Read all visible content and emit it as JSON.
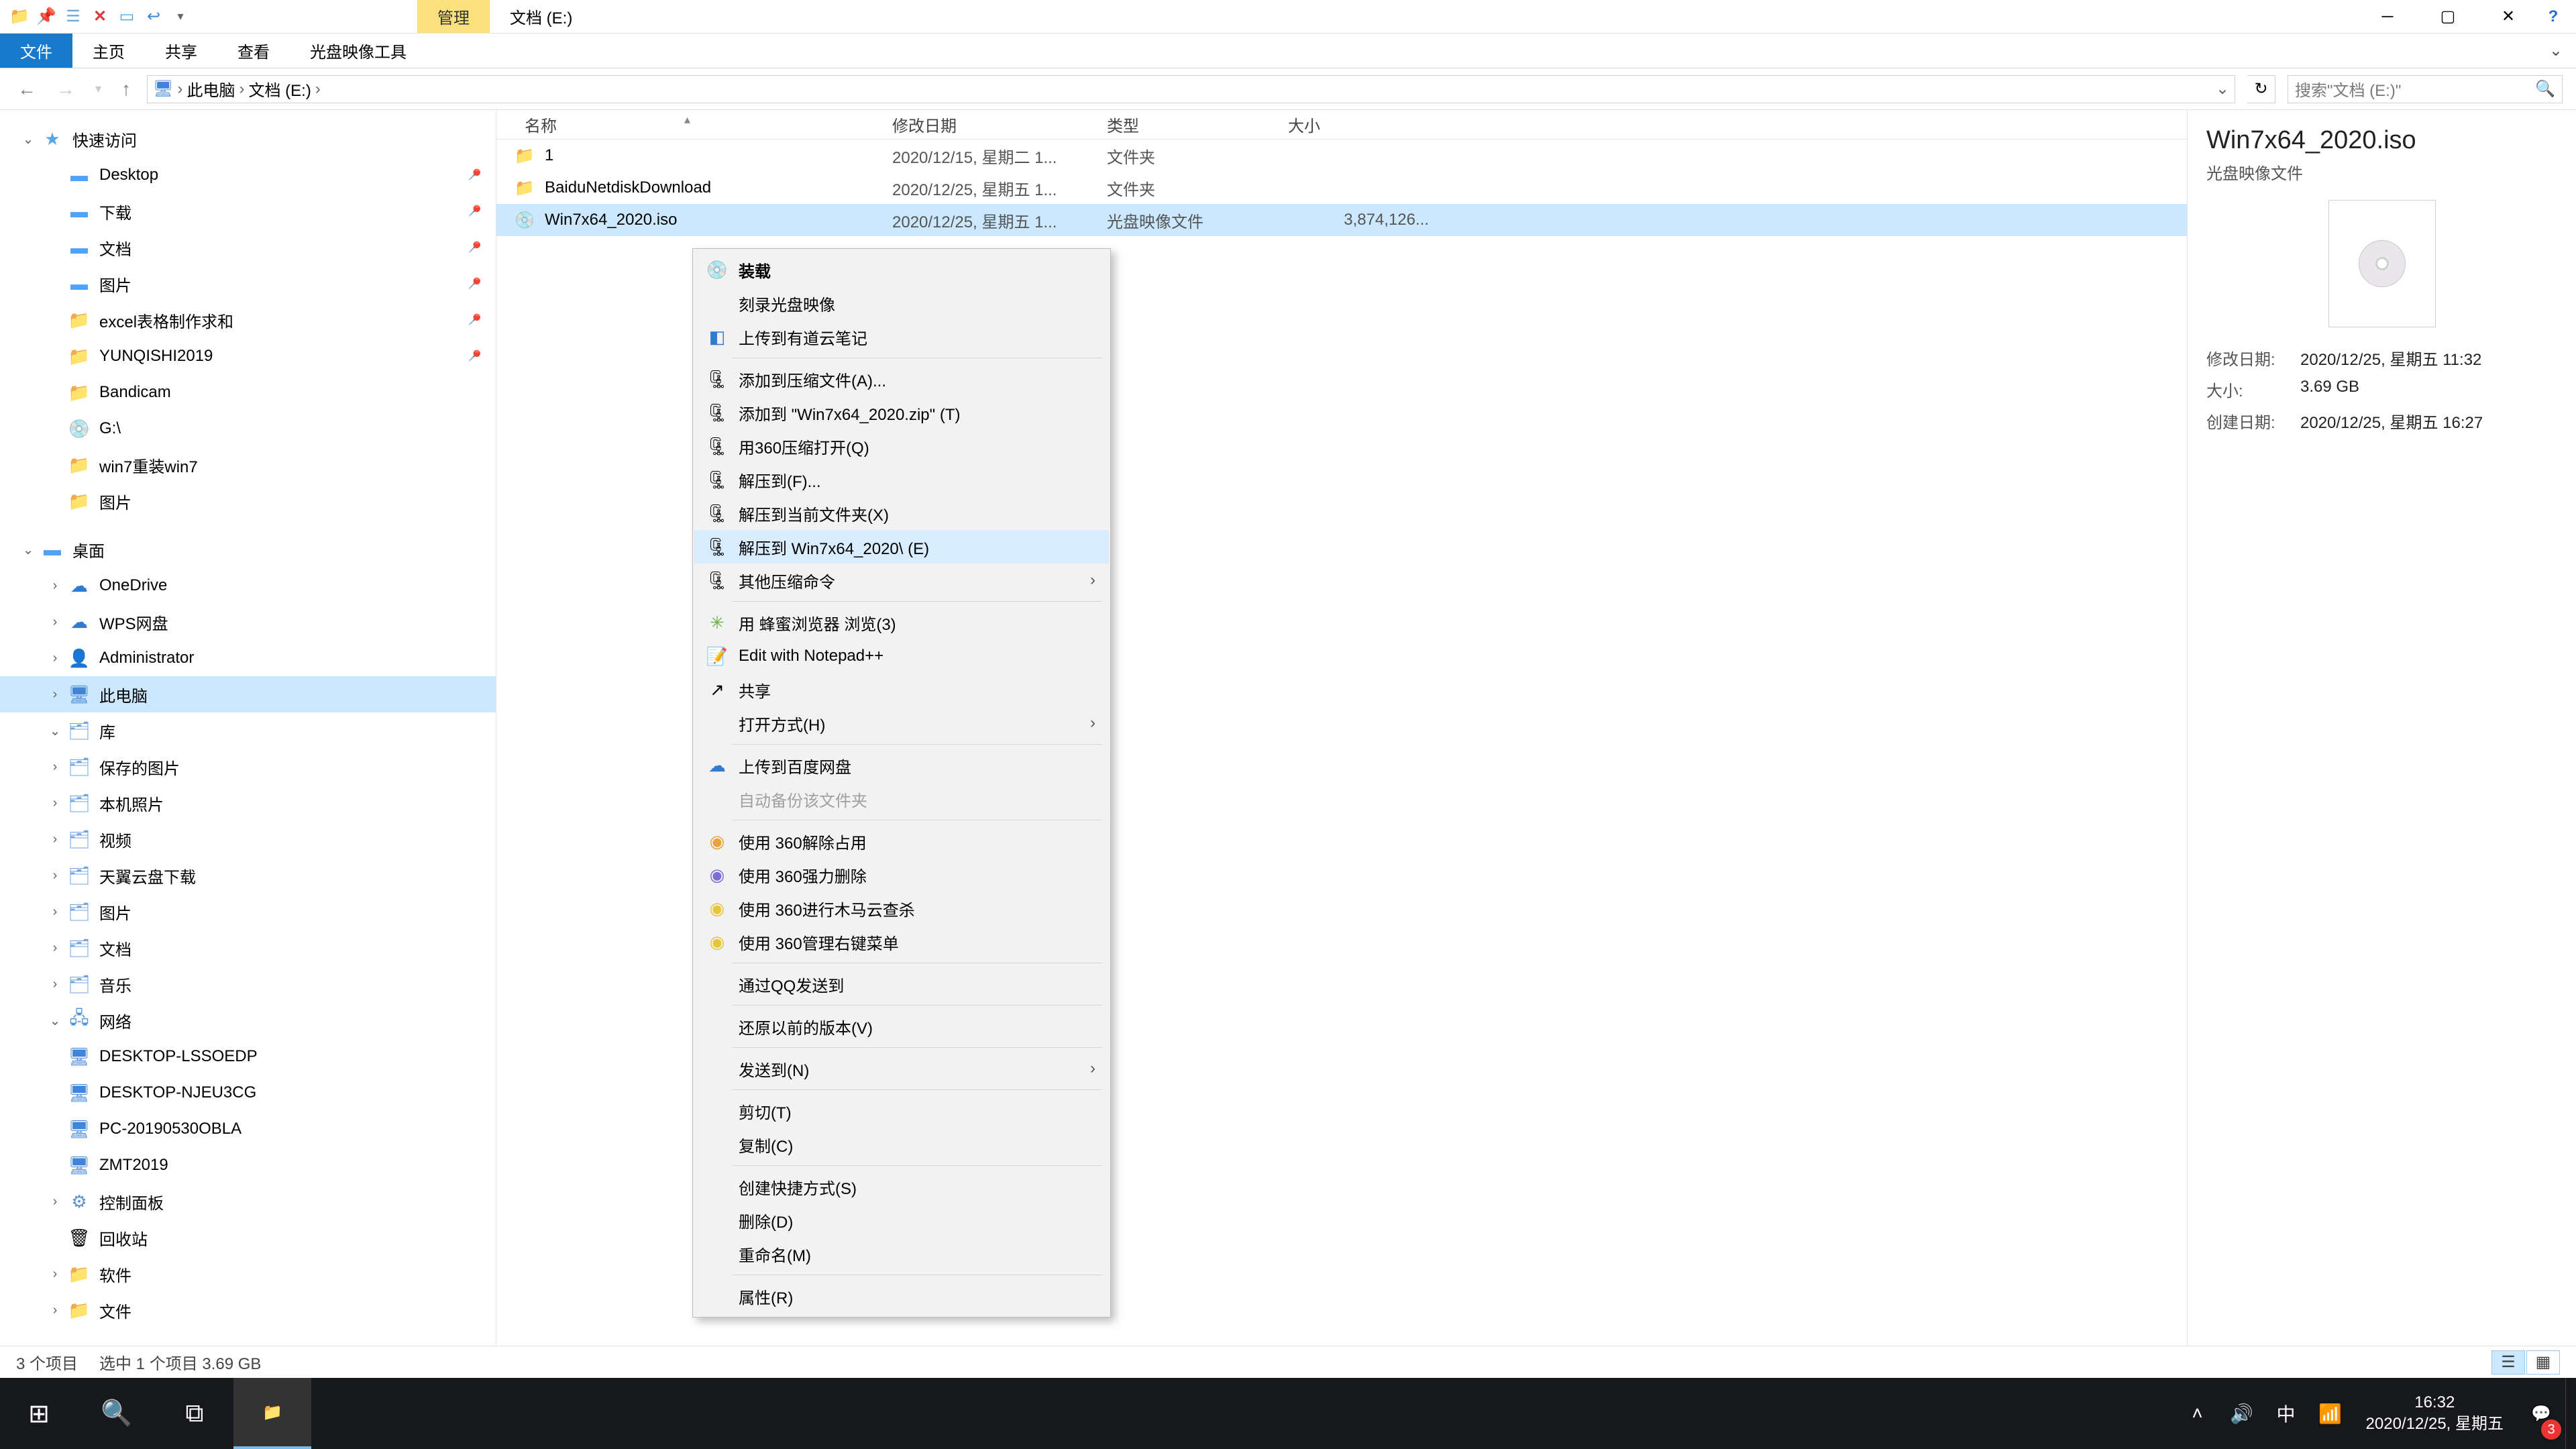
{
  "title_bar": {
    "ribbon_context_tab": "管理",
    "path_label": "文档 (E:)"
  },
  "ribbon": {
    "file": "文件",
    "home": "主页",
    "share": "共享",
    "view": "查看",
    "disc_tools": "光盘映像工具"
  },
  "breadcrumb": {
    "root": "此电脑",
    "current": "文档 (E:)"
  },
  "search": {
    "placeholder": "搜索\"文档 (E:)\""
  },
  "tree": {
    "quick": "快速访问",
    "desktop": "Desktop",
    "downloads": "下载",
    "documents": "文档",
    "pictures": "图片",
    "excel": "excel表格制作求和",
    "yunqishi": "YUNQISHI2019",
    "bandicam": "Bandicam",
    "gdrive": "G:\\",
    "win7reinstall": "win7重装win7",
    "pictures2": "图片",
    "desktop2": "桌面",
    "onedrive": "OneDrive",
    "wps": "WPS网盘",
    "admin": "Administrator",
    "thispc": "此电脑",
    "lib": "库",
    "savedpics": "保存的图片",
    "camera": "本机照片",
    "videos": "视频",
    "tianyi": "天翼云盘下载",
    "pictures3": "图片",
    "documents2": "文档",
    "music": "音乐",
    "network": "网络",
    "pc1": "DESKTOP-LSSOEDP",
    "pc2": "DESKTOP-NJEU3CG",
    "pc3": "PC-20190530OBLA",
    "pc4": "ZMT2019",
    "cpanel": "控制面板",
    "recycle": "回收站",
    "software": "软件",
    "files": "文件"
  },
  "columns": {
    "name": "名称",
    "date": "修改日期",
    "type": "类型",
    "size": "大小"
  },
  "rows": [
    {
      "name": "1",
      "date": "2020/12/15, 星期二 1...",
      "type": "文件夹",
      "size": ""
    },
    {
      "name": "BaiduNetdiskDownload",
      "date": "2020/12/25, 星期五 1...",
      "type": "文件夹",
      "size": ""
    },
    {
      "name": "Win7x64_2020.iso",
      "date": "2020/12/25, 星期五 1...",
      "type": "光盘映像文件",
      "size": "3,874,126..."
    }
  ],
  "context_menu": {
    "mount": "装载",
    "burn": "刻录光盘映像",
    "youdao": "上传到有道云笔记",
    "add_archive": "添加到压缩文件(A)...",
    "add_zip": "添加到 \"Win7x64_2020.zip\" (T)",
    "open360": "用360压缩打开(Q)",
    "extract_to": "解压到(F)...",
    "extract_here": "解压到当前文件夹(X)",
    "extract_named": "解压到 Win7x64_2020\\ (E)",
    "other_comp": "其他压缩命令",
    "bee_browser": "用 蜂蜜浏览器 浏览(3)",
    "notepadpp": "Edit with Notepad++",
    "share": "共享",
    "open_with": "打开方式(H)",
    "baidu_upload": "上传到百度网盘",
    "auto_backup": "自动备份该文件夹",
    "unlock360": "使用 360解除占用",
    "force_del360": "使用 360强力删除",
    "trojan360": "使用 360进行木马云查杀",
    "menu360": "使用 360管理右键菜单",
    "qq_send": "通过QQ发送到",
    "restore_prev": "还原以前的版本(V)",
    "send_to": "发送到(N)",
    "cut": "剪切(T)",
    "copy": "复制(C)",
    "shortcut": "创建快捷方式(S)",
    "delete": "删除(D)",
    "rename": "重命名(M)",
    "properties": "属性(R)"
  },
  "details": {
    "title": "Win7x64_2020.iso",
    "type": "光盘映像文件",
    "mod_key": "修改日期:",
    "mod_val": "2020/12/25, 星期五 11:32",
    "size_key": "大小:",
    "size_val": "3.69 GB",
    "created_key": "创建日期:",
    "created_val": "2020/12/25, 星期五 16:27"
  },
  "status": {
    "count": "3 个项目",
    "selected": "选中 1 个项目  3.69 GB"
  },
  "taskbar": {
    "ime": "中",
    "time": "16:32",
    "date": "2020/12/25, 星期五",
    "badge": "3"
  }
}
